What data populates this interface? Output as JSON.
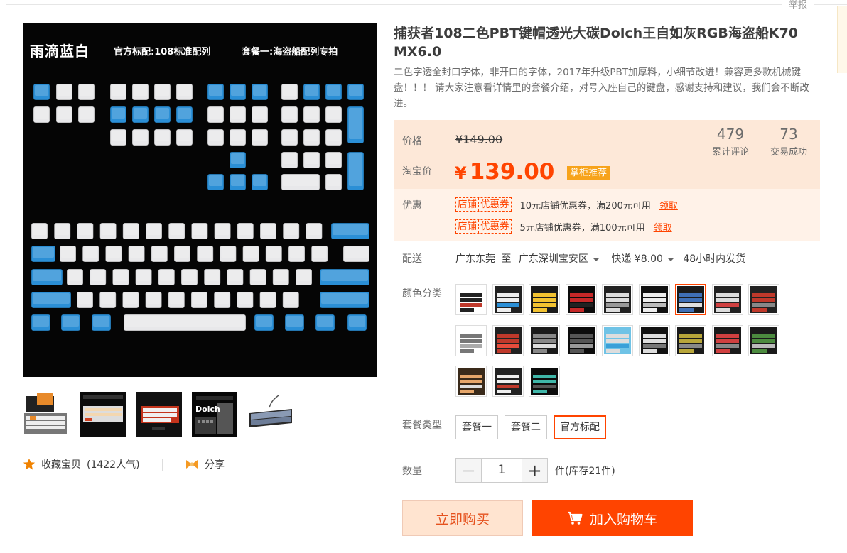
{
  "report_label": "举报",
  "gallery": {
    "banner": {
      "name": "雨滴蓝白",
      "spec": "官方标配:108标准配列",
      "package": "套餐一:海盗船配列专拍"
    },
    "thumb_dolch_text": "Dolch",
    "favorite_label": "收藏宝贝",
    "favorite_count": "(1422人气)",
    "share_label": "分享"
  },
  "product": {
    "title": "捕获者108二色PBT键帽透光大碳Dolch王自如灰RGB海盗船K70 MX6.0",
    "subtitle": "二色字透全封口字体，非开口的字体，2017年升级PBT加厚料，小细节改进！兼容更多款机械键盘！！！ 请大家注意看详情里的套餐介绍，对号入座自己的键盘，感谢支持和建议，我们会不断改进。"
  },
  "price": {
    "label": "价格",
    "original": "¥149.00",
    "taobao_label": "淘宝价",
    "currency": "¥",
    "current": "139.00",
    "tag": "掌柜推荐",
    "reviews_count": "479",
    "reviews_label": "累计评论",
    "deals_count": "73",
    "deals_label": "交易成功"
  },
  "promo": {
    "label": "优惠",
    "badge_left": "店铺",
    "badge_right": "优惠券",
    "coupons": [
      {
        "text": "10元店铺优惠券，满200元可用",
        "action": "领取"
      },
      {
        "text": "5元店铺优惠券，满100元可用",
        "action": "领取"
      }
    ]
  },
  "shipping": {
    "label": "配送",
    "from": "广东东莞",
    "to_word": "至",
    "to": "广东深圳宝安区",
    "method": "快递 ¥8.00",
    "time": "48小时内发货"
  },
  "color": {
    "label": "颜色分类",
    "selected_index": 6,
    "count": 21
  },
  "package": {
    "label": "套餐类型",
    "options": [
      "套餐一",
      "套餐二",
      "官方标配"
    ],
    "selected_index": 2
  },
  "quantity": {
    "label": "数量",
    "value": "1",
    "minus": "−",
    "plus": "+",
    "stock": "件(库存21件)"
  },
  "buttons": {
    "buy_now": "立即购买",
    "add_cart": "加入购物车"
  },
  "colors": {
    "accent": "#ff4400",
    "price_bg": "#fde8d8",
    "key_blue": "#2b8fd6",
    "key_white": "#e8e8ea"
  }
}
